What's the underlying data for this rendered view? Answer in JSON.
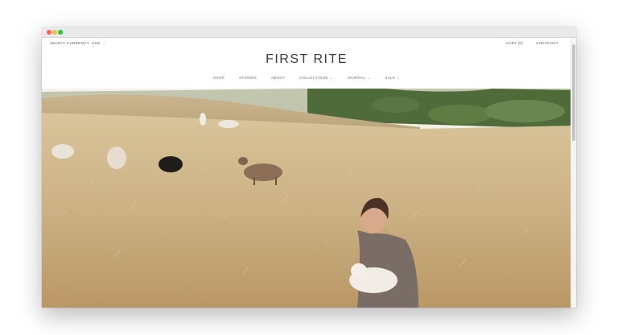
{
  "header": {
    "currency_label": "SELECT CURRENCY",
    "currency_value": "USD",
    "cart_label": "CART (0)",
    "checkout_label": "CHECKOUT"
  },
  "brand": {
    "logo": "FIRST RITE"
  },
  "nav": {
    "items": [
      {
        "label": "SHOP",
        "dropdown": false
      },
      {
        "label": "STORIES",
        "dropdown": false
      },
      {
        "label": "ABOUT",
        "dropdown": false
      },
      {
        "label": "COLLECTIONS",
        "dropdown": true
      },
      {
        "label": "JOURNAL",
        "dropdown": true
      },
      {
        "label": "SALE",
        "dropdown": true
      }
    ]
  },
  "hero": {
    "icon": "photo-hero-image"
  },
  "colors": {
    "accent_text": "#3a3a3a",
    "nav_text": "#666666"
  }
}
